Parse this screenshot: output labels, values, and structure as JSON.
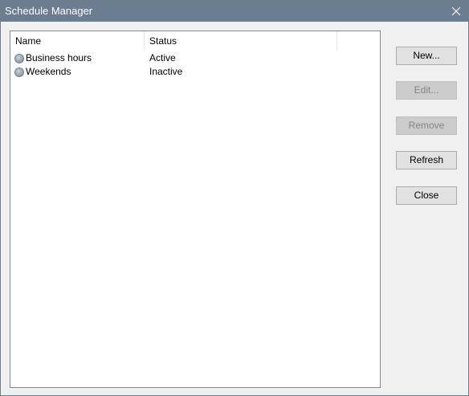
{
  "window": {
    "title": "Schedule Manager"
  },
  "list": {
    "columns": [
      "Name",
      "Status"
    ],
    "rows": [
      {
        "name": "Business hours",
        "status": "Active",
        "icon": "schedule-icon"
      },
      {
        "name": "Weekends",
        "status": "Inactive",
        "icon": "schedule-icon"
      }
    ]
  },
  "buttons": {
    "new_label": "New...",
    "edit_label": "Edit...",
    "remove_label": "Remove",
    "refresh_label": "Refresh",
    "close_label": "Close"
  },
  "colors": {
    "titlebar": "#6b7d90",
    "dialog_background": "#f0f0f0",
    "button_face": "#e1e1e1",
    "button_disabled": "#cccccc"
  }
}
